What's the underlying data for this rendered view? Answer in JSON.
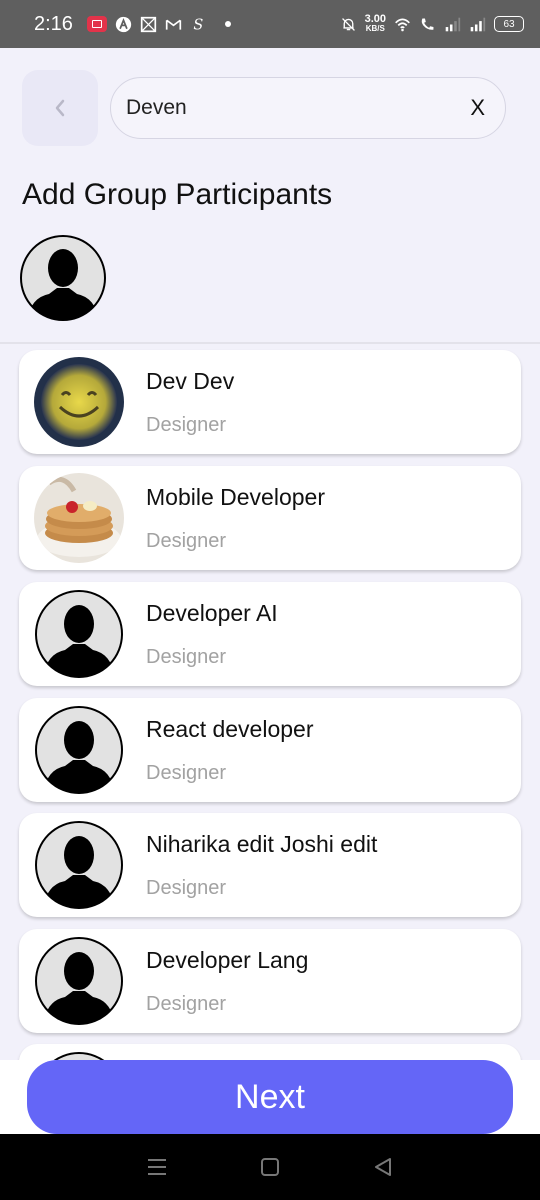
{
  "status_bar": {
    "time": "2:16",
    "speed_value": "3.00",
    "speed_unit": "KB/S",
    "battery": "63"
  },
  "header": {
    "search_value": "Deven",
    "clear_label": "X"
  },
  "page_title": "Add Group Participants",
  "participants": [
    {
      "name": "Dev Dev",
      "role": "Designer"
    },
    {
      "name": "Mobile Developer",
      "role": "Designer"
    },
    {
      "name": "Developer AI",
      "role": "Designer"
    },
    {
      "name": "React developer",
      "role": "Designer"
    },
    {
      "name": "Niharika edit Joshi edit",
      "role": "Designer"
    },
    {
      "name": "Developer Lang",
      "role": "Designer"
    }
  ],
  "next_button_label": "Next",
  "colors": {
    "accent": "#6466f7",
    "background": "#f2f1fa",
    "role_text": "#a2a2a2"
  }
}
